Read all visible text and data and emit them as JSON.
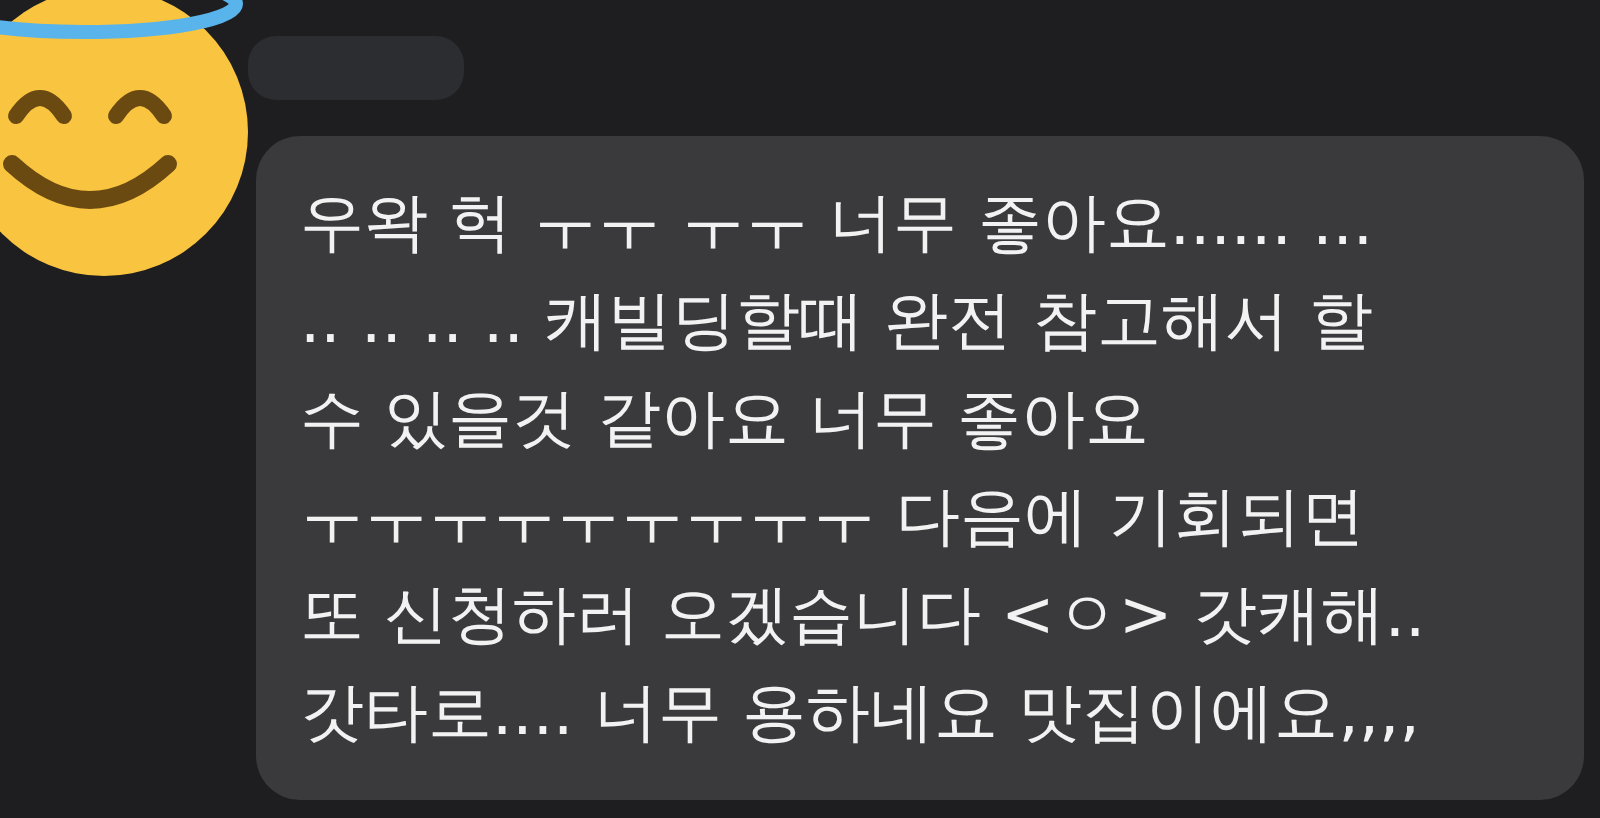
{
  "message": {
    "sender_hidden": true,
    "lines": [
      "우왁 헉 ㅜㅜ ㅜㅜ 너무 좋아요...... ...",
      ".. .. .. .. 캐빌딩할때 완전 참고해서 할",
      "수 있을것 같아요 너무 좋아요",
      "ㅜㅜㅜㅜㅜㅜㅜㅜㅜ 다음에 기회되면",
      "또 신청하러 오겠습니다 <ㅇ> 갓캐해..",
      "갓타로.... 너무 용하네요 맛집이에요,,,,"
    ]
  }
}
